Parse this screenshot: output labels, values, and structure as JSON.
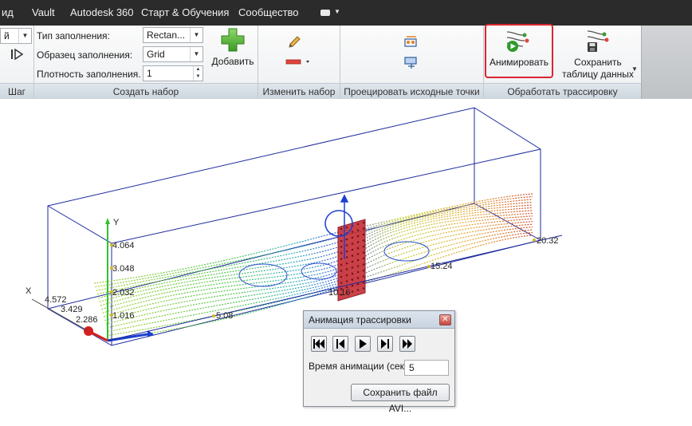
{
  "menu": {
    "items": [
      "ид",
      "Vault",
      "Autodesk 360",
      "Старт & Обучения",
      "Сообщество"
    ]
  },
  "ribbon": {
    "panels": {
      "step": "Шаг",
      "create_set": "Создать набор",
      "edit_set": "Изменить набор",
      "project_points": "Проецировать исходные точки",
      "process_trace": "Обработать трассировку"
    },
    "fill_type": {
      "label": "Тип заполнения:",
      "value": "Rectan..."
    },
    "fill_pattern": {
      "label": "Образец заполнения:",
      "value": "Grid"
    },
    "fill_density": {
      "label": "Плотность заполнения.",
      "value": "1"
    },
    "left_combo_value": "й",
    "add_label": "Добавить",
    "animate_label": "Анимировать",
    "save_table_label_1": "Сохранить",
    "save_table_label_2": "таблицу данных"
  },
  "viewport": {
    "axis_y_label": "Y",
    "axis_x_label": "X",
    "y_ticks": [
      "4.064",
      "3.048",
      "2.032",
      "1.016"
    ],
    "x_ticks": [
      "4.572",
      "3.429",
      "2.286"
    ],
    "z_ticks": [
      "5.08",
      "10.16",
      "15.24",
      "20.32"
    ]
  },
  "dialog": {
    "title": "Анимация трассировки",
    "time_label": "Время анимации (сек.)",
    "time_value": "5",
    "save_avi": "Сохранить файл AVI..."
  },
  "colors": {
    "menubar": "#2b2b2b",
    "highlight": "#d9262f",
    "plane": "#c8323a",
    "bbox": "#1c2a9c"
  }
}
